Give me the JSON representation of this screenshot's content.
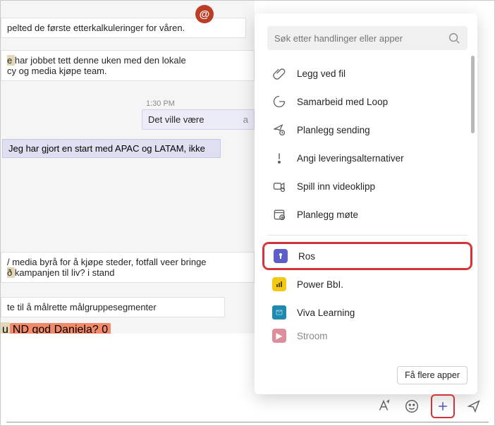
{
  "chat": {
    "msg1": "pelted de første etterkalkuleringer for våren.",
    "msg2a": "har jobbet tett denne uken med den lokale",
    "msg2b": "cy og media kjøpe team.",
    "reply_time": "1:30 PM",
    "reply_text": "Det ville være",
    "reply_suffix": "a",
    "msg3": "Jeg har gjort en start med APAC og LATAM, ikke",
    "msg4a": "/ media byrå for å kjøpe steder, fotfall veer bringe",
    "msg4b": "kampanjen til liv? i stand",
    "msg5": "te til å målrette målgruppesegmenter",
    "msg6": "ND god Daniela? 0"
  },
  "popup": {
    "search_placeholder": "Søk etter handlinger eller apper",
    "actions": [
      {
        "label": "Legg ved fil",
        "icon": "attach"
      },
      {
        "label": "Samarbeid med Loop",
        "icon": "loop"
      },
      {
        "label": "Planlegg sending",
        "icon": "send-later"
      },
      {
        "label": "Angi leveringsalternativer",
        "icon": "priority"
      },
      {
        "label": "Spill inn videoklipp",
        "icon": "video"
      },
      {
        "label": "Planlegg møte",
        "icon": "calendar"
      }
    ],
    "apps": [
      {
        "label": "Ros",
        "badge_bg": "#5b5fc7",
        "highlighted": true
      },
      {
        "label": "Power BbI.",
        "badge_bg": "#f2c811"
      },
      {
        "label": "Viva Learning",
        "badge_bg": "#1e8ab0"
      },
      {
        "label": "Stroom",
        "badge_bg": "#c4314b"
      }
    ],
    "more_button": "Få flere apper"
  },
  "at_symbol": "@"
}
